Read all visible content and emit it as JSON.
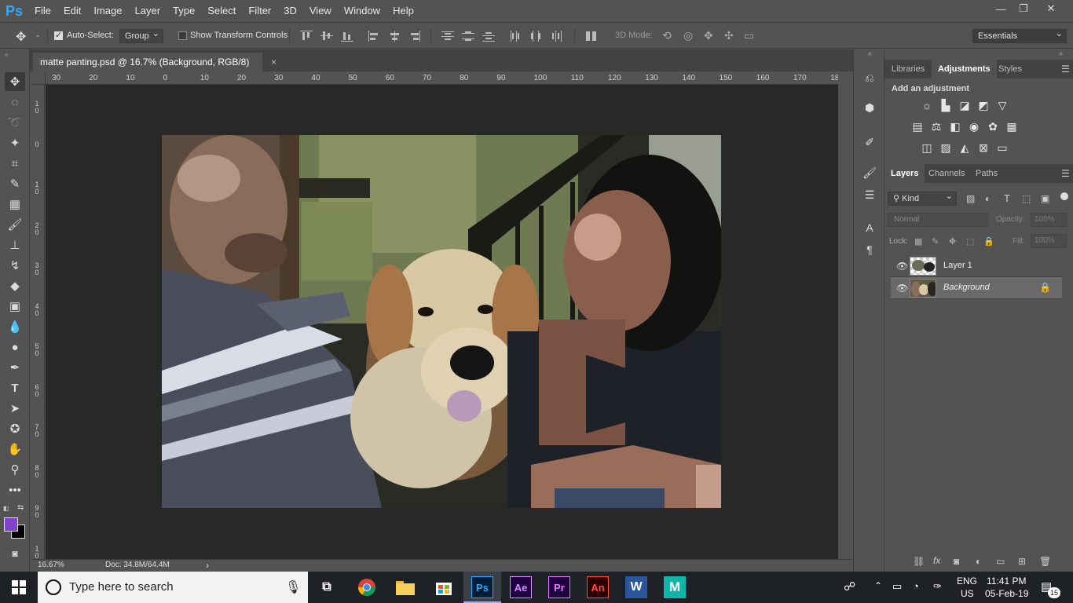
{
  "app": {
    "logo": "Ps"
  },
  "menu": [
    "File",
    "Edit",
    "Image",
    "Layer",
    "Type",
    "Select",
    "Filter",
    "3D",
    "View",
    "Window",
    "Help"
  ],
  "window_controls": {
    "minimize": "—",
    "restore": "❐",
    "close": "✕"
  },
  "options": {
    "auto_select_label": "Auto-Select:",
    "auto_select_checked": true,
    "group_value": "Group",
    "show_transform_label": "Show Transform Controls",
    "show_transform_checked": false,
    "mode_3d_label": "3D Mode:",
    "workspace_value": "Essentials"
  },
  "document": {
    "tab_title": "matte panting.psd @ 16.7% (Background, RGB/8)",
    "close": "×"
  },
  "ruler": {
    "top_labels": [
      "30",
      "20",
      "10",
      "0",
      "10",
      "20",
      "30",
      "40",
      "50",
      "60",
      "70",
      "80",
      "90",
      "100",
      "110",
      "120",
      "130",
      "140",
      "150",
      "160",
      "170",
      "18"
    ],
    "left_labels": [
      "1 0",
      "0",
      "1 0",
      "2 0",
      "3 0",
      "4 0",
      "5 0",
      "6 0",
      "7 0",
      "8 0",
      "9 0",
      "1 0"
    ]
  },
  "status": {
    "zoom": "16.67%",
    "doc": "Doc: 34.8M/64.4M",
    "arrow": "›"
  },
  "panels": {
    "top_tabs": [
      "Libraries",
      "Adjustments",
      "Styles"
    ],
    "top_active": "Adjustments",
    "adjustments_title": "Add an adjustment",
    "layer_tabs": [
      "Layers",
      "Channels",
      "Paths"
    ],
    "layer_active": "Layers",
    "kind_value": "Kind",
    "blend_mode": "Normal",
    "opacity_label": "Opacity:",
    "opacity_value": "100%",
    "lock_label": "Lock:",
    "fill_label": "Fill:",
    "fill_value": "100%",
    "layers": [
      {
        "name": "Layer 1",
        "visible": true,
        "selected": false
      },
      {
        "name": "Background",
        "visible": true,
        "selected": true,
        "locked": true
      }
    ]
  },
  "taskbar": {
    "search_placeholder": "Type here to search",
    "apps": [
      "Ps",
      "Ae",
      "Pr",
      "An",
      "W",
      "M"
    ],
    "lang_top": "ENG",
    "lang_bottom": "US",
    "time": "11:41 PM",
    "date": "05-Feb-19",
    "notifications": "15"
  },
  "colors": {
    "foreground": "#8043c9",
    "background": "#000000",
    "accent": "#31a8ff"
  }
}
